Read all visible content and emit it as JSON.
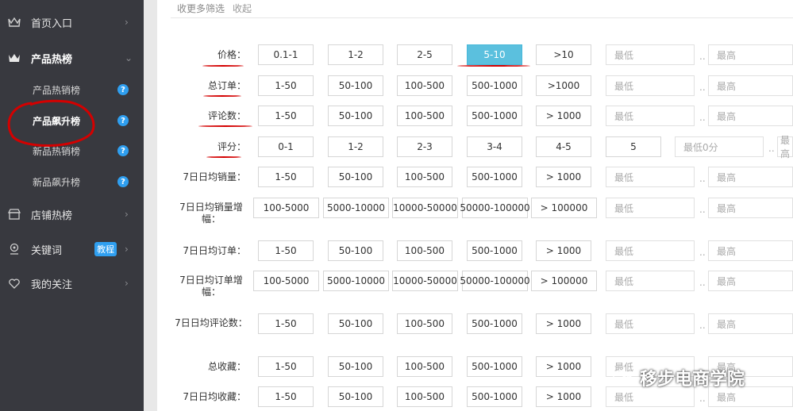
{
  "sidebar": {
    "items": [
      {
        "label": "首页入口",
        "icon": "crown-icon"
      },
      {
        "label": "产品热榜",
        "icon": "crown-icon"
      },
      {
        "label": "店铺热榜",
        "icon": "store-icon"
      },
      {
        "label": "关键词",
        "icon": "location-pin-icon",
        "badge": "教程"
      },
      {
        "label": "我的关注",
        "icon": "heart-icon"
      }
    ],
    "sub_items": [
      {
        "label": "产品热销榜"
      },
      {
        "label": "产品飙升榜"
      },
      {
        "label": "新品热销榜"
      },
      {
        "label": "新品飙升榜"
      }
    ]
  },
  "header": {
    "more_filters": "收更多筛选",
    "fold": "收起"
  },
  "filters": {
    "min_placeholder": "最低",
    "max_placeholder": "最高",
    "rating_min_placeholder": "最低0分",
    "range_sep": "..",
    "rows": [
      {
        "label": "价格：",
        "options": [
          "0.1-1",
          "1-2",
          "2-5",
          "5-10",
          ">10"
        ],
        "selected": 3
      },
      {
        "label": "总订单：",
        "options": [
          "1-50",
          "50-100",
          "100-500",
          "500-1000",
          ">1000"
        ]
      },
      {
        "label": "评论数：",
        "options": [
          "1-50",
          "50-100",
          "100-500",
          "500-1000",
          "> 1000"
        ]
      },
      {
        "label": "评分：",
        "options": [
          "0-1",
          "1-2",
          "2-3",
          "3-4",
          "4-5",
          "5"
        ]
      },
      {
        "label": "7日日均销量：",
        "options": [
          "1-50",
          "50-100",
          "100-500",
          "500-1000",
          "> 1000"
        ]
      },
      {
        "label": "7日日均销量增幅：",
        "options": [
          "100-5000",
          "5000-10000",
          "10000-50000",
          "50000-100000",
          "> 100000"
        ]
      },
      {
        "label": "7日日均订单：",
        "options": [
          "1-50",
          "50-100",
          "100-500",
          "500-1000",
          "> 1000"
        ]
      },
      {
        "label": "7日日均订单增幅：",
        "options": [
          "100-5000",
          "5000-10000",
          "10000-50000",
          "50000-100000",
          "> 100000"
        ]
      },
      {
        "label": "7日日均评论数：",
        "options": [
          "1-50",
          "50-100",
          "100-500",
          "500-1000",
          "> 1000"
        ]
      },
      {
        "label": "总收藏：",
        "options": [
          "1-50",
          "50-100",
          "100-500",
          "500-1000",
          "> 1000"
        ]
      },
      {
        "label": "7日日均收藏：",
        "options": [
          "1-50",
          "50-100",
          "100-500",
          "500-1000",
          "> 1000"
        ]
      }
    ]
  },
  "watermark": {
    "text": "移步电商学院"
  },
  "colors": {
    "sidebar_bg": "#38393f",
    "selected": "#5bc0de",
    "badge": "#2f9ff0",
    "annotation": "#d40000"
  }
}
